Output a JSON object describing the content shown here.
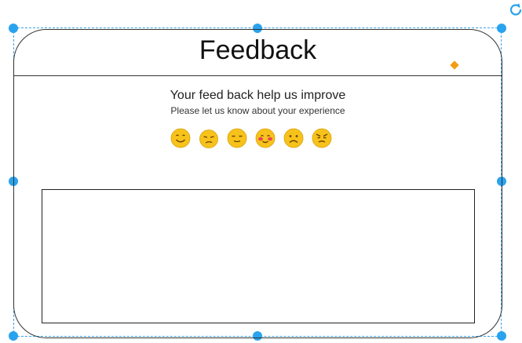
{
  "form": {
    "title": "Feedback",
    "heading": "Your feed back help us improve",
    "subheading": "Please let us know about your experience"
  },
  "emojis": [
    {
      "icon": "smile-icon"
    },
    {
      "icon": "unamused-icon"
    },
    {
      "icon": "relieved-icon"
    },
    {
      "icon": "blush-icon"
    },
    {
      "icon": "frown-icon"
    },
    {
      "icon": "angry-icon"
    }
  ],
  "feedback_box": {
    "value": ""
  },
  "colors": {
    "selection": "#29a3ee",
    "diamond": "#f39c12",
    "emoji_face": "#f7c21b",
    "blush": "#e8465a"
  }
}
